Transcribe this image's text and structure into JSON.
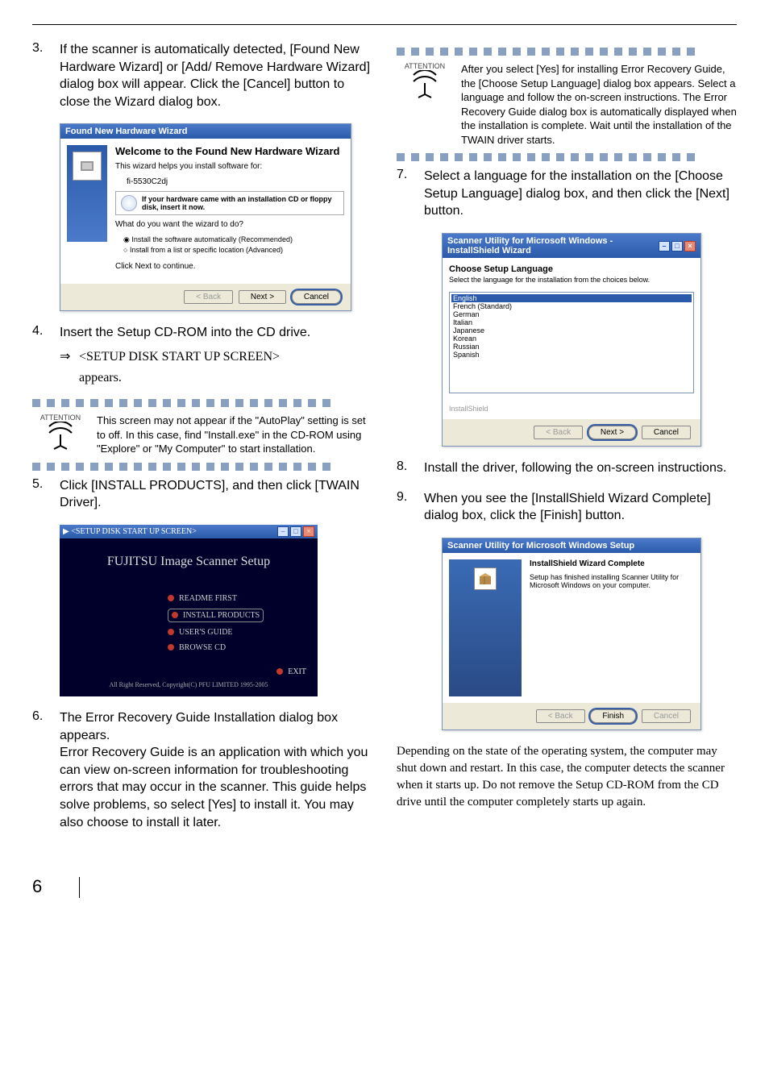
{
  "left": {
    "step3": {
      "num": "3.",
      "text": "If the scanner is automatically detected, [Found New Hardware Wizard] or [Add/ Remove Hardware Wizard] dialog box will appear. Click the [Cancel] button to close the Wizard dialog box."
    },
    "hw": {
      "title": "Found New Hardware Wizard",
      "heading": "Welcome to the Found New Hardware Wizard",
      "sub": "This wizard helps you install software for:",
      "model": "fi-5530C2dj",
      "warn": "If your hardware came with an installation CD or floppy disk, insert it now.",
      "question": "What do you want the wizard to do?",
      "opt1": "Install the software automatically (Recommended)",
      "opt2": "Install from a list or specific location (Advanced)",
      "cont": "Click Next to continue.",
      "back": "< Back",
      "next": "Next >",
      "cancel": "Cancel"
    },
    "step4": {
      "num": "4.",
      "text": "Insert the Setup CD-ROM into the CD drive.",
      "arrow": "⇒",
      "sub1": "<SETUP DISK START UP SCREEN>",
      "sub2": "appears."
    },
    "attn1": {
      "label": "ATTENTION",
      "text": "This screen may not appear if the \"AutoPlay\" setting is set to off. In this case, find \"Install.exe\" in the CD-ROM using \"Explore\" or \"My Computer\" to start installation."
    },
    "step5": {
      "num": "5.",
      "text": "Click [INSTALL PRODUCTS], and then click [TWAIN Driver]."
    },
    "setup": {
      "wintitle": "<SETUP DISK START UP SCREEN>",
      "heading": "FUJITSU Image Scanner Setup",
      "item1": "README FIRST",
      "item2": "INSTALL PRODUCTS",
      "item3": "USER'S GUIDE",
      "item4": "BROWSE CD",
      "exit": "EXIT",
      "copy": "All Right Reserved, Copyright(C) PFU LIMITED 1995-2005"
    },
    "step6": {
      "num": "6.",
      "text": "The Error Recovery Guide Installation dialog box appears.\nError Recovery Guide is an application with which you can view on-screen information for troubleshooting errors that may occur in the scanner. This guide helps solve problems, so select [Yes] to install it. You may also choose to install it later."
    }
  },
  "right": {
    "attn2": {
      "label": "ATTENTION",
      "text": "After you select [Yes] for installing Error Recovery Guide, the [Choose Setup Language] dialog box appears. Select a language and follow the on-screen instructions. The Error Recovery Guide dialog box is automatically displayed when the installation is complete. Wait until the installation of the TWAIN driver starts."
    },
    "step7": {
      "num": "7.",
      "text": "Select a language for the installation on the [Choose Setup Language] dialog box, and then click the [Next] button."
    },
    "lang": {
      "title": "Scanner Utility for Microsoft Windows - InstallShield Wizard",
      "head": "Choose Setup Language",
      "sub": "Select the language for the installation from the choices below.",
      "items": [
        "English",
        "French (Standard)",
        "German",
        "Italian",
        "Japanese",
        "Korean",
        "Russian",
        "Spanish"
      ],
      "frame": "InstallShield",
      "back": "< Back",
      "next": "Next >",
      "cancel": "Cancel"
    },
    "step8": {
      "num": "8.",
      "text": "Install the driver, following the on-screen instructions."
    },
    "step9": {
      "num": "9.",
      "text": "When you see the [InstallShield Wizard Complete] dialog box, click the [Finish] button."
    },
    "ic": {
      "title": "Scanner Utility for Microsoft Windows Setup",
      "h": "InstallShield Wizard Complete",
      "body": "Setup has finished installing Scanner Utility for Microsoft Windows on your computer.",
      "back": "< Back",
      "finish": "Finish",
      "cancel": "Cancel"
    },
    "closing": "Depending on the state of the operating system, the computer may shut down and restart. In this case, the computer detects the scanner when it starts up. Do not remove the Setup CD-ROM from the CD drive until the computer completely starts up again."
  },
  "pagenum": "6"
}
